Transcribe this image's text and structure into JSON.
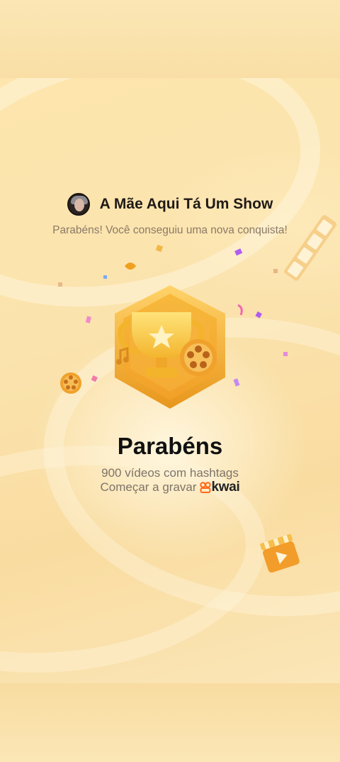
{
  "profile": {
    "username": "A Mãe Aqui Tá Um Show",
    "avatar_icon": "profile-photo"
  },
  "achievement": {
    "subtitle": "Parabéns! Você conseguiu uma nova conquista!",
    "title": "Parabéns",
    "description": "900 vídeos com hashtags",
    "cta_text": "Começar a gravar",
    "brand": "kwai",
    "badge_icon": "trophy-badge-icon"
  },
  "colors": {
    "background": "#fbe3ae",
    "badge_gold": "#f2a623",
    "brand_orange": "#ff6a1a",
    "confetti_purple": "#b15cf0",
    "confetti_pink": "#f06ab0"
  }
}
